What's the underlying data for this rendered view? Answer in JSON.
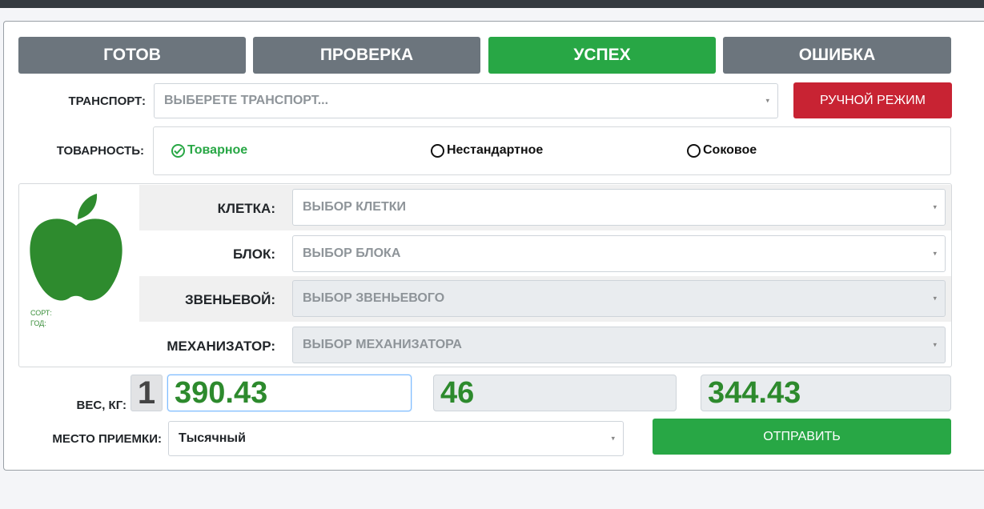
{
  "status_buttons": [
    {
      "label": "ГОТОВ",
      "color": "#6c757d"
    },
    {
      "label": "ПРОВЕРКА",
      "color": "#6c757d"
    },
    {
      "label": "УСПЕХ",
      "color": "#28a745"
    },
    {
      "label": "ОШИБКА",
      "color": "#6c757d"
    }
  ],
  "transport": {
    "label": "ТРАНСПОРТ:",
    "placeholder": "ВЫБЕРЕТЕ ТРАНСПОРТ...",
    "manual_button": "РУЧНОЙ РЕЖИМ"
  },
  "quality": {
    "label": "ТОВАРНОСТЬ:",
    "options": [
      "Товарное",
      "Нестандартное",
      "Соковое"
    ],
    "selected": "Товарное"
  },
  "apple": {
    "icon": "apple-icon",
    "color": "#2e8b2e",
    "sort_label": "СОРТ:",
    "year_label": "ГОД:"
  },
  "fields": [
    {
      "label": "КЛЕТКА:",
      "placeholder": "ВЫБОР КЛЕТКИ",
      "disabled": false
    },
    {
      "label": "БЛОК:",
      "placeholder": "ВЫБОР БЛОКА",
      "disabled": false
    },
    {
      "label": "ЗВЕНЬЕВОЙ:",
      "placeholder": "ВЫБОР ЗВЕНЬЕВОГО",
      "disabled": true
    },
    {
      "label": "МЕХАНИЗАТОР:",
      "placeholder": "ВЫБОР МЕХАНИЗАТОРА",
      "disabled": true
    }
  ],
  "weight": {
    "label": "ВЕС, КГ:",
    "index": "1",
    "gross": "390.43",
    "tare": "46",
    "net": "344.43"
  },
  "location": {
    "label": "МЕСТО ПРИЕМКИ:",
    "value": "Тысячный"
  },
  "submit_label": "ОТПРАВИТЬ",
  "caret_glyph": "⌄"
}
